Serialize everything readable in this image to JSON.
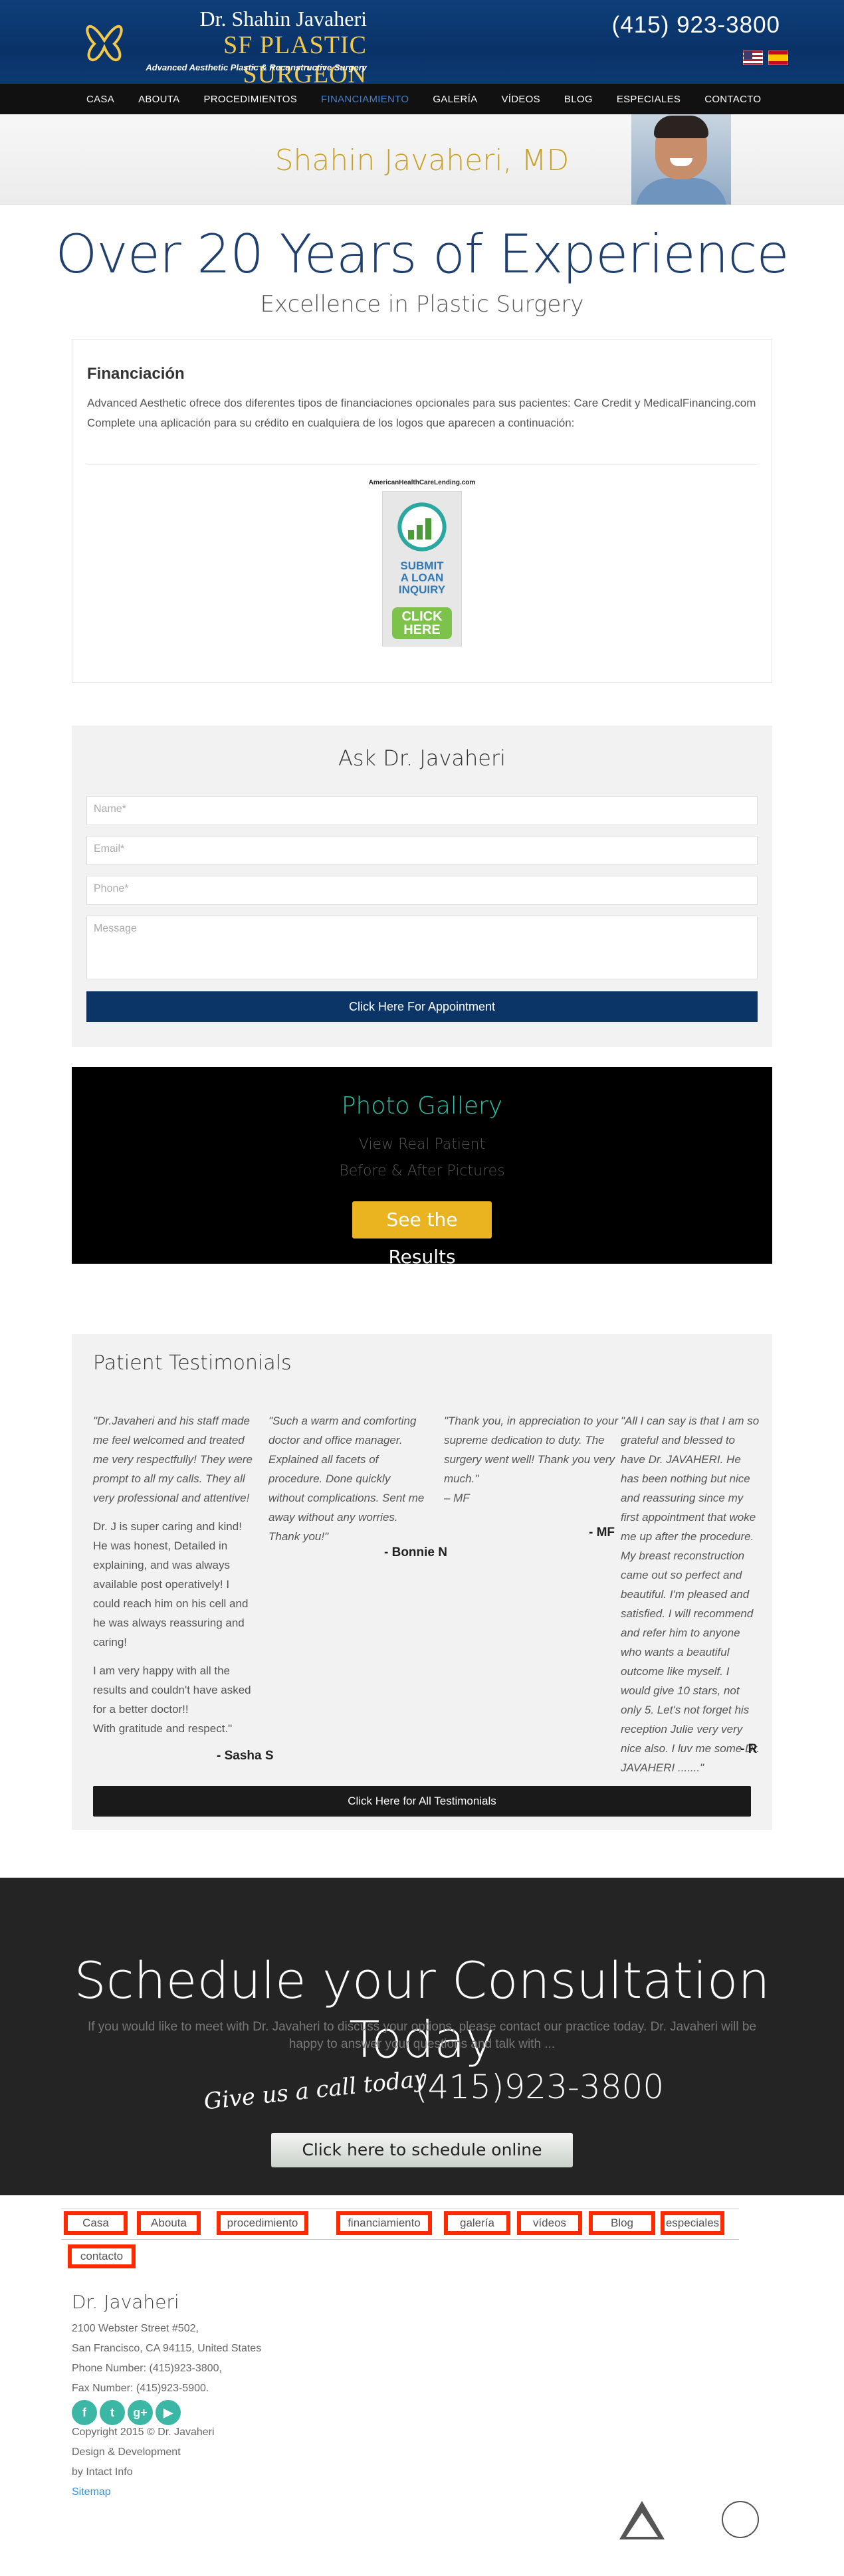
{
  "header": {
    "doctor_name": "Dr. Shahin Javaheri",
    "brand": "SF PLASTIC SURGEON",
    "tagline": "Advanced Aesthetic Plastic & Reconstructive Surgery",
    "phone": "(415) 923-3800",
    "flags": [
      "us-flag",
      "spain-flag"
    ]
  },
  "nav": {
    "items": [
      "CASA",
      "ABOUTA",
      "PROCEDIMIENTOS",
      "FINANCIAMIENTO",
      "GALERÍA",
      "VÍDEOS",
      "BLOG",
      "ESPECIALES",
      "CONTACTO"
    ],
    "active_index": 3,
    "active_color": "#4a7fc1"
  },
  "banner": {
    "name": "Shahin Javaheri, MD"
  },
  "hero": {
    "title": "Over 20 Years of Experience",
    "subtitle": "Excellence in Plastic Surgery"
  },
  "finance": {
    "title": "Financiación",
    "text1": "Advanced Aesthetic ofrece dos diferentes tipos de financiaciones opcionales para sus pacientes: Care Credit y MedicalFinancing.com",
    "text2": "Complete una aplicación para su crédito en cualquiera de los logos que aparecen a continuación:",
    "ad": {
      "site": "AmericanHealthCareLending.com",
      "submit": "SUBMIT",
      "a_loan": "A LOAN",
      "inquiry": "INQUIRY",
      "click": "CLICK",
      "here": "HERE"
    }
  },
  "ask": {
    "title": "Ask Dr. Javaheri",
    "name_placeholder": "Name*",
    "email_placeholder": "Email*",
    "phone_placeholder": "Phone*",
    "message_placeholder": "Message",
    "button": "Click Here For Appointment"
  },
  "gallery": {
    "title": "Photo Gallery",
    "line1": "View Real Patient",
    "line2": "Before & After Pictures",
    "button": "See the Results"
  },
  "testimonials": {
    "title": "Patient Testimonials",
    "t1": {
      "quote": "\"Dr.Javaheri and his staff made me feel welcomed and treated me very respectfully! They were prompt to all my calls. They all very professional and attentive!",
      "p2": "Dr. J is super caring and kind! He was honest, Detailed in explaining, and was always available post operatively! I could reach him on his cell and he was always reassuring and caring!",
      "p3": "I am very happy with all the results and couldn't have asked for a better doctor!!",
      "p4": "With gratitude and respect.\"",
      "sig": "- Sasha S"
    },
    "t2": {
      "quote": "\"Such a warm and comforting doctor and office manager. Explained all facets of procedure. Done quickly without complications. Sent me away without any worries. Thank you!\"",
      "sig": "- Bonnie N"
    },
    "t3": {
      "quote": "\"Thank you, in appreciation to your supreme dedication to duty. The surgery went well! Thank you very much.\"",
      "sign_inline": "– MF",
      "sig": "- MF"
    },
    "t4": {
      "quote": "\"All I can say is that I am so grateful and blessed to have Dr. JAVAHERI. He has been nothing but nice and reassuring since my first appointment that woke me up after the procedure. My breast reconstruction came out so perfect and beautiful. I'm pleased and satisfied. I will recommend and refer him to anyone who wants a beautiful outcome like myself. I would give 10 stars, not only 5. Let's not forget his reception Julie very very nice also. I luv me some Dr. JAVAHERI .......\"",
      "sig": "- R"
    },
    "button": "Click Here for All Testimonials"
  },
  "schedule": {
    "title": "Schedule your Consultation Today",
    "text": "If you would like to meet with Dr. Javaheri to discuss your options, please contact our practice today. Dr. Javaheri will be happy to answer your questions and talk with ...",
    "call": "Give us a call today",
    "phone": "(415)923-3800",
    "button": "Click here to schedule online"
  },
  "footer": {
    "nav": [
      "Casa",
      "Abouta",
      "procedimiento",
      "financiamiento",
      "galería",
      "vídeos",
      "Blog",
      "especiales",
      "contacto"
    ],
    "doctor": "Dr. Javaheri",
    "address1": "2100 Webster Street #502,",
    "address2": "San Francisco, CA 94115, United States",
    "phone": "Phone Number: (415)923-3800,",
    "fax": "Fax Number: (415)923-5900.",
    "social": [
      "facebook-icon",
      "twitter-icon",
      "google-plus-icon",
      "youtube-icon"
    ],
    "copyright": "Copyright 2015 © Dr. Javaheri",
    "design1": "Design & Development",
    "design2": "by Intact Info",
    "sitemap": "Sitemap"
  }
}
